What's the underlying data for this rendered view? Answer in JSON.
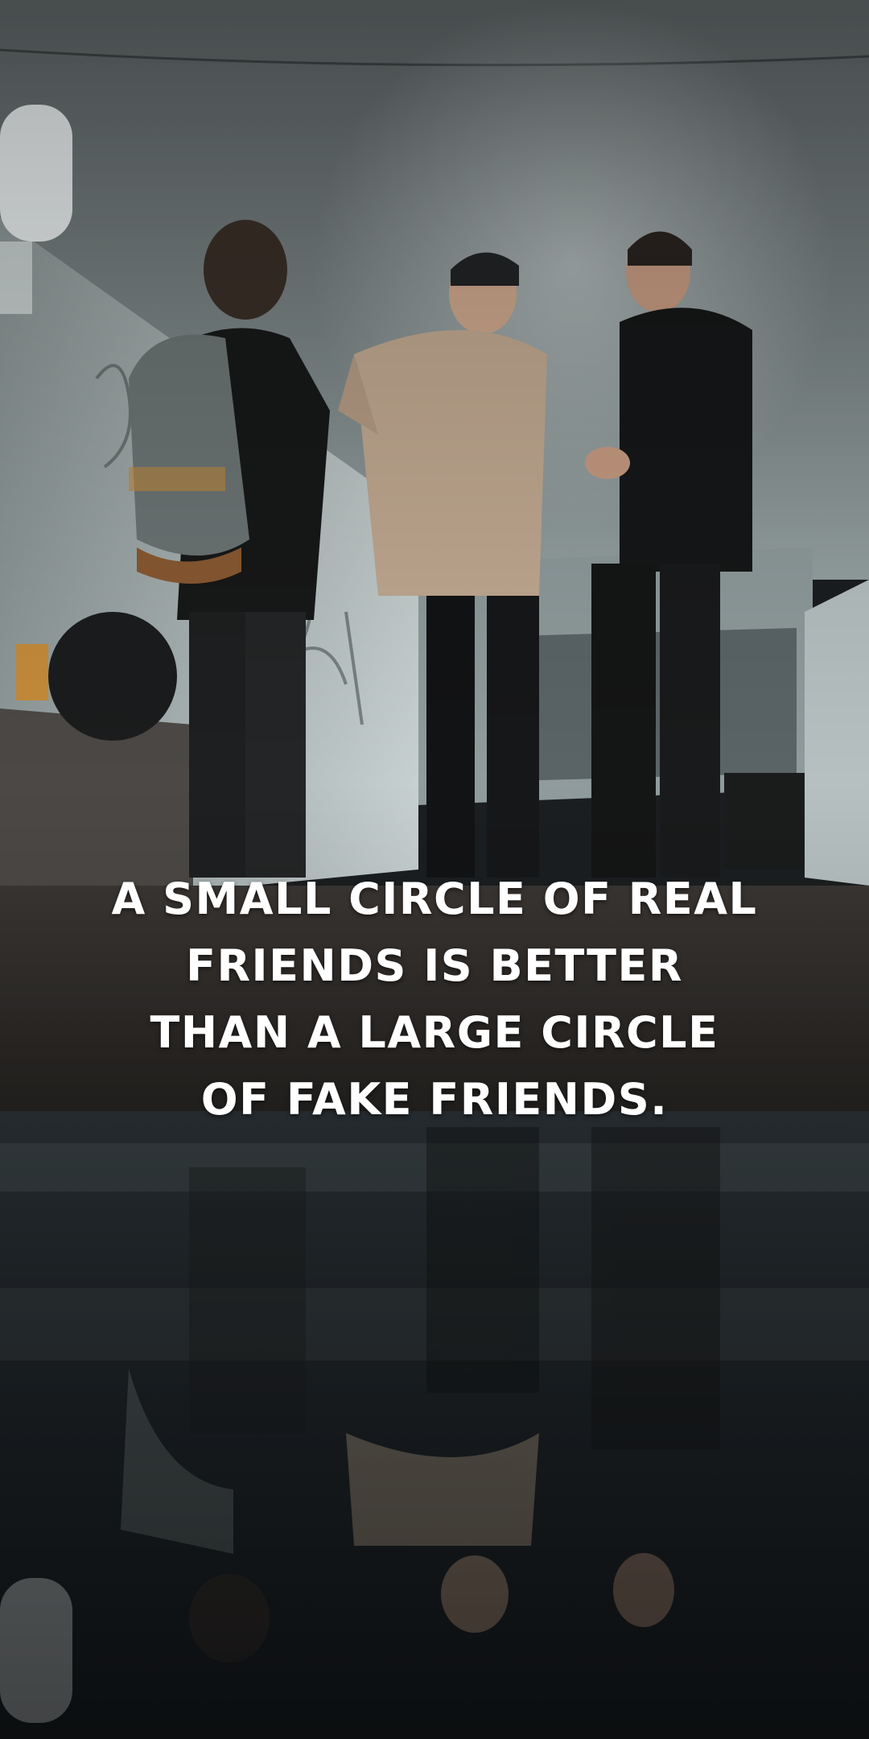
{
  "quote": {
    "lines": [
      "A SMALL CIRCLE OF REAL",
      "FRIENDS IS BETTER",
      "THAN A LARGE CIRCLE",
      "OF FAKE FRIENDS."
    ]
  },
  "colors": {
    "text": "#ffffff",
    "ceiling": "#6f7778",
    "wall_left": "#a9b3b3",
    "floor": "#2a2826",
    "puddle": "#1c2226",
    "hoodie": "#c2aa92",
    "jacket": "#151718",
    "backpack": "#6c7575"
  },
  "image": {
    "subject": "three-young-men-in-underpass-with-reflection-in-puddle"
  }
}
